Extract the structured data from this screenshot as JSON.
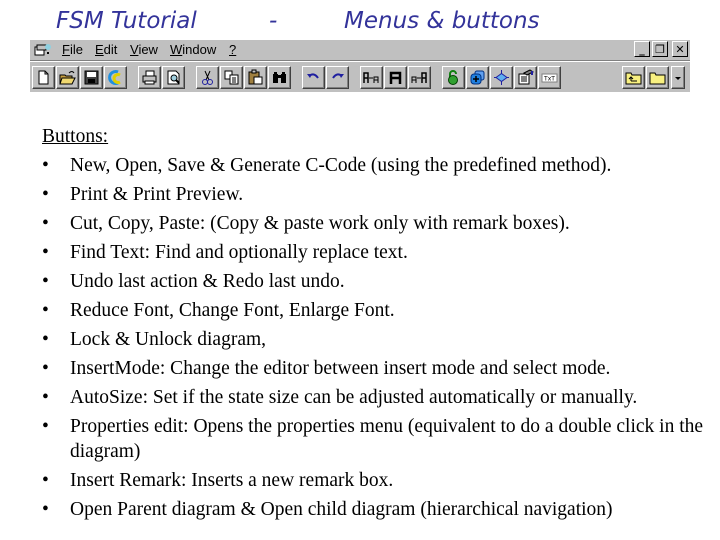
{
  "slide": {
    "title_left": "FSM  Tutorial",
    "title_dash": "-",
    "title_right": "Menus & buttons",
    "title_color": "#33339a"
  },
  "menubar": {
    "items": [
      {
        "label": "File",
        "accel": "F"
      },
      {
        "label": "Edit",
        "accel": "E"
      },
      {
        "label": "View",
        "accel": "V"
      },
      {
        "label": "Window",
        "accel": "W"
      },
      {
        "label": "?",
        "accel": "?"
      }
    ],
    "window_controls": {
      "minimize": "_",
      "restore": "❐",
      "close": "✕"
    }
  },
  "toolbar": {
    "groups": [
      [
        "new-icon",
        "open-icon",
        "save-icon",
        "generate-c-code-icon"
      ],
      [
        "print-icon",
        "print-preview-icon"
      ],
      [
        "cut-icon",
        "copy-icon",
        "paste-icon",
        "find-icon"
      ],
      [
        "undo-icon",
        "redo-icon"
      ],
      [
        "reduce-font-icon",
        "change-font-icon",
        "enlarge-font-icon"
      ],
      [
        "lock-icon",
        "insert-mode-icon",
        "autosize-icon",
        "properties-icon",
        "insert-remark-icon"
      ],
      [
        "open-parent-icon",
        "open-child-icon",
        "dropdown-arrow-icon"
      ]
    ],
    "remark_icon_text": "TxT"
  },
  "content": {
    "heading": "Buttons:",
    "bullet_glyph": "•",
    "items": [
      "New, Open, Save & Generate C-Code (using the predefined method).",
      "Print & Print Preview.",
      "Cut, Copy, Paste: (Copy & paste work only with remark boxes).",
      "Find Text: Find and optionally replace text.",
      "Undo last action & Redo last undo.",
      "Reduce Font, Change Font, Enlarge Font.",
      "Lock & Unlock diagram,",
      "InsertMode: Change the editor between insert mode and select mode.",
      "AutoSize: Set if the state size can be adjusted automatically or manually.",
      "Properties edit: Opens the properties menu (equivalent to do a double click in the diagram)",
      "Insert Remark: Inserts a new remark box.",
      "Open Parent diagram & Open child diagram (hierarchical navigation)"
    ]
  }
}
